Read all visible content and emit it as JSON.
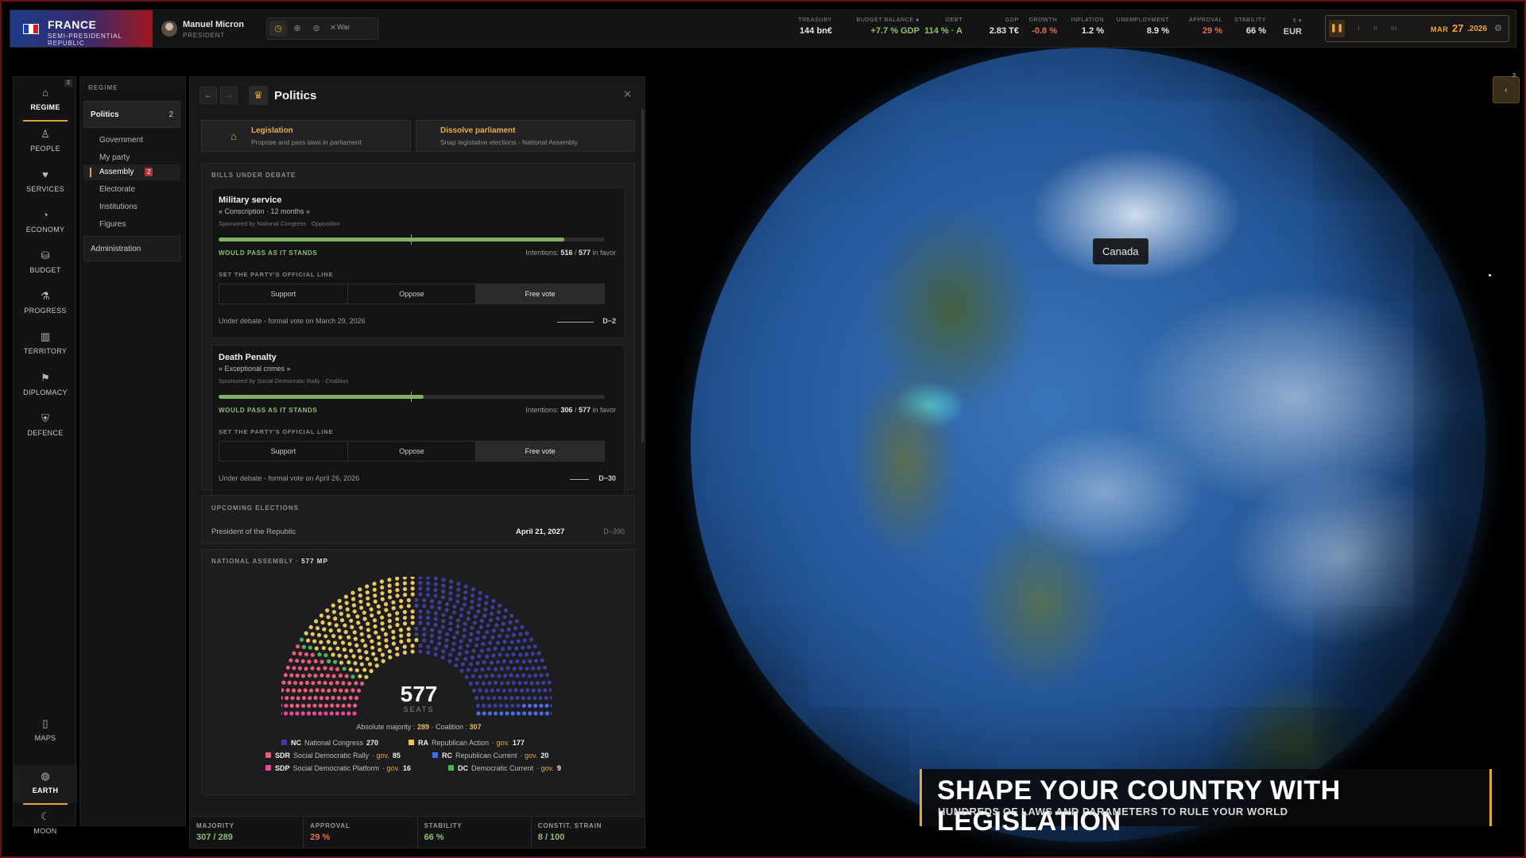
{
  "country": {
    "name": "FRANCE",
    "subtitle": "SEMI-PRESIDENTIAL REPUBLIC"
  },
  "leader": {
    "name": "Manuel Micron",
    "role": "PRESIDENT"
  },
  "modes": {
    "war_label": "War"
  },
  "stats": [
    {
      "label": "TREASURY",
      "value": "144 bn€",
      "color": "#e6e6e6"
    },
    {
      "label": "BUDGET BALANCE ●",
      "value": "+7.7 % GDP",
      "color": "#8fc06a"
    },
    {
      "label": "DEBT",
      "value": "114 % · A",
      "color": "#8fc06a"
    },
    {
      "label": "GDP",
      "value": "2.83 T€",
      "color": "#e6e6e6"
    },
    {
      "label": "GROWTH",
      "value": "-0.8 %",
      "color": "#e0704a"
    },
    {
      "label": "INFLATION",
      "value": "1.2 %",
      "color": "#e6e6e6"
    },
    {
      "label": "UNEMPLOYMENT",
      "value": "8.9 %",
      "color": "#e6e6e6"
    },
    {
      "label": "APPROVAL",
      "value": "29 %",
      "color": "#e0704a"
    },
    {
      "label": "STABILITY",
      "value": "66 %",
      "color": "#e6e6e6"
    },
    {
      "label": "€ ▾",
      "value": "EUR",
      "color": "#cfcfcf"
    }
  ],
  "date": {
    "month": "MAR",
    "day": "27",
    "year": ".2026"
  },
  "nav": [
    {
      "label": "REGIME",
      "icon": "⌂"
    },
    {
      "label": "PEOPLE",
      "icon": "♙"
    },
    {
      "label": "SERVICES",
      "icon": "♥"
    },
    {
      "label": "ECONOMY",
      "icon": "◔"
    },
    {
      "label": "BUDGET",
      "icon": "⛁"
    },
    {
      "label": "PROGRESS",
      "icon": "⚗"
    },
    {
      "label": "TERRITORY",
      "icon": "▥"
    },
    {
      "label": "DIPLOMACY",
      "icon": "⚑"
    },
    {
      "label": "DEFENCE",
      "icon": "⛨"
    }
  ],
  "nav_bottom": [
    {
      "label": "MAPS",
      "icon": "▯"
    },
    {
      "label": "EARTH",
      "icon": "◍"
    },
    {
      "label": "MOON",
      "icon": "☾"
    }
  ],
  "regime_count": "2",
  "subnav": {
    "title": "REGIME",
    "politics": "Politics",
    "politics_count": "2",
    "items": [
      "Government",
      "My party"
    ],
    "assembly": "Assembly",
    "assembly_badge": "2",
    "items2": [
      "Electorate",
      "Institutions",
      "Figures"
    ],
    "administration": "Administration"
  },
  "panel": {
    "title": "Politics",
    "actions": [
      {
        "title": "Legislation",
        "sub": "Propose and pass laws in parliament"
      },
      {
        "title": "Dissolve parliament",
        "sub": "Snap legislative elections - National Assembly"
      }
    ],
    "bills_title": "BILLS UNDER DEBATE",
    "line_label": "SET THE PARTY'S OFFICIAL LINE",
    "pass_label": "WOULD PASS AS IT STANDS",
    "options": [
      "Support",
      "Oppose",
      "Free vote"
    ],
    "bills": [
      {
        "name": "Military service",
        "sub": "« Conscription · 12 months »",
        "sponsor": "Sponsored by National Congress · Opposition",
        "favor": 516,
        "total": 577,
        "favor_text": "516",
        "total_text": "577",
        "debate": "Under debate - formal vote on March 29, 2026",
        "countdown": "D−2"
      },
      {
        "name": "Death Penalty",
        "sub": "« Exceptional crimes »",
        "sponsor": "Sponsored by Social Democratic Rally · Coalition",
        "favor": 306,
        "total": 577,
        "favor_text": "306",
        "total_text": "577",
        "debate": "Under debate - formal vote on April 26, 2026",
        "countdown": "D−30"
      }
    ],
    "intentions_prefix": "Intentions:",
    "intentions_suffix": "in favor",
    "elections_title": "UPCOMING ELECTIONS",
    "election": {
      "name": "President of the Republic",
      "date": "April 21, 2027",
      "countdown": "D−390"
    },
    "assembly_title": "NATIONAL ASSEMBLY · ",
    "assembly_seats_label": "577 MP",
    "seats_label": "SEATS",
    "majority_prefix": "Absolute majority :",
    "majority_value": "289",
    "coalition_prefix": "· Coalition :",
    "coalition_value": "307",
    "gov_label": "· gov."
  },
  "chart_data": {
    "type": "parliament",
    "total": 577,
    "parties": [
      {
        "abbr": "NC",
        "name": "National Congress",
        "seats": 270,
        "gov": false,
        "color": "#3a3e9a"
      },
      {
        "abbr": "RA",
        "name": "Republican Action",
        "seats": 177,
        "gov": true,
        "color": "#e8c85a"
      },
      {
        "abbr": "SDR",
        "name": "Social Democratic Rally",
        "seats": 85,
        "gov": true,
        "color": "#e85a7a"
      },
      {
        "abbr": "RC",
        "name": "Republican Current",
        "seats": 20,
        "gov": true,
        "color": "#4a6ae8"
      },
      {
        "abbr": "SDP",
        "name": "Social Democratic Platform",
        "seats": 16,
        "gov": true,
        "color": "#e84a9a"
      },
      {
        "abbr": "DC",
        "name": "Democratic Current",
        "seats": 9,
        "gov": true,
        "color": "#4ab85a"
      }
    ]
  },
  "footer": [
    {
      "label": "MAJORITY",
      "value": "307 / 289",
      "color": "#8fc06a"
    },
    {
      "label": "APPROVAL",
      "value": "29 %",
      "color": "#e0704a"
    },
    {
      "label": "STABILITY",
      "value": "66 %",
      "color": "#8fc06a"
    },
    {
      "label": "CONSTIT. STRAIN",
      "value": "8 / 100",
      "color": "#8fc06a"
    }
  ],
  "globe": {
    "tooltip": "Canada"
  },
  "collapse_count": "3",
  "banner": {
    "title": "SHAPE YOUR COUNTRY WITH LEGISLATION",
    "sub": "HUNDREDS OF LAWS AND PARAMETERS TO RULE YOUR WORLD"
  }
}
